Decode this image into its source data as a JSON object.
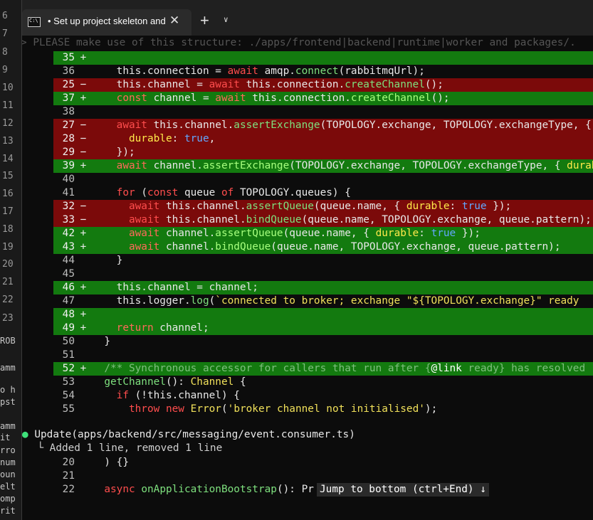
{
  "tab": {
    "title": "• Set up project skeleton and"
  },
  "left_gutter": {
    "numbers": [
      "6",
      "7",
      "8",
      "9",
      "10",
      "11",
      "12",
      "13",
      "14",
      "15",
      "16",
      "17",
      "18",
      "19",
      "20",
      "21",
      "22",
      "23"
    ],
    "fragments": [
      "ROB",
      "amm",
      "o h",
      "pst",
      "amm",
      "it",
      "rro",
      "num",
      "oun",
      "elt",
      "omp",
      "rit"
    ]
  },
  "prompt": "> PLEASE make use of this structure: ./apps/frontend|backend|runtime|worker and packages/.",
  "diff": [
    {
      "n": "35",
      "m": "+",
      "t": "add",
      "code": ""
    },
    {
      "n": "36",
      "m": "",
      "t": "ctx",
      "code": "    this.connection = await amqp.connect(rabbitmqUrl);"
    },
    {
      "n": "25",
      "m": "-",
      "t": "del",
      "code": "    this.channel = await this.connection.createChannel();"
    },
    {
      "n": "37",
      "m": "+",
      "t": "add",
      "code": "    const channel = await this.connection.createChannel();"
    },
    {
      "n": "38",
      "m": "",
      "t": "ctx",
      "code": ""
    },
    {
      "n": "27",
      "m": "-",
      "t": "del",
      "code": "    await this.channel.assertExchange(TOPOLOGY.exchange, TOPOLOGY.exchangeType, {"
    },
    {
      "n": "28",
      "m": "-",
      "t": "del",
      "code": "      durable: true,"
    },
    {
      "n": "29",
      "m": "-",
      "t": "del",
      "code": "    });"
    },
    {
      "n": "39",
      "m": "+",
      "t": "add",
      "code": "    await channel.assertExchange(TOPOLOGY.exchange, TOPOLOGY.exchangeType, { durable"
    },
    {
      "n": "40",
      "m": "",
      "t": "ctx",
      "code": ""
    },
    {
      "n": "41",
      "m": "",
      "t": "ctx",
      "code": "    for (const queue of TOPOLOGY.queues) {"
    },
    {
      "n": "32",
      "m": "-",
      "t": "del",
      "code": "      await this.channel.assertQueue(queue.name, { durable: true });"
    },
    {
      "n": "33",
      "m": "-",
      "t": "del",
      "code": "      await this.channel.bindQueue(queue.name, TOPOLOGY.exchange, queue.pattern);"
    },
    {
      "n": "42",
      "m": "+",
      "t": "add",
      "code": "      await channel.assertQueue(queue.name, { durable: true });"
    },
    {
      "n": "43",
      "m": "+",
      "t": "add",
      "code": "      await channel.bindQueue(queue.name, TOPOLOGY.exchange, queue.pattern);"
    },
    {
      "n": "44",
      "m": "",
      "t": "ctx",
      "code": "    }"
    },
    {
      "n": "45",
      "m": "",
      "t": "ctx",
      "code": ""
    },
    {
      "n": "46",
      "m": "+",
      "t": "add",
      "code": "    this.channel = channel;"
    },
    {
      "n": "47",
      "m": "",
      "t": "ctx",
      "code": "    this.logger.log(`connected to broker; exchange \"${TOPOLOGY.exchange}\" ready"
    },
    {
      "n": "48",
      "m": "+",
      "t": "add",
      "code": ""
    },
    {
      "n": "49",
      "m": "+",
      "t": "add",
      "code": "    return channel;"
    },
    {
      "n": "50",
      "m": "",
      "t": "ctx",
      "code": "  }"
    },
    {
      "n": "51",
      "m": "",
      "t": "ctx",
      "code": ""
    },
    {
      "n": "52",
      "m": "+",
      "t": "add",
      "code": "  /** Synchronous accessor for callers that run after {@link ready} has resolved"
    },
    {
      "n": "53",
      "m": "",
      "t": "ctx",
      "code": "  getChannel(): Channel {"
    },
    {
      "n": "54",
      "m": "",
      "t": "ctx",
      "code": "    if (!this.channel) {"
    },
    {
      "n": "55",
      "m": "",
      "t": "ctx",
      "code": "      throw new Error('broker channel not initialised');"
    }
  ],
  "update": {
    "bullet": "●",
    "text": "Update(apps/backend/src/messaging/event.consumer.ts)",
    "summary": "  └ Added 1 line, removed 1 line"
  },
  "diff2": [
    {
      "n": "20",
      "m": "",
      "t": "ctx",
      "code": "  ) {}"
    },
    {
      "n": "21",
      "m": "",
      "t": "ctx",
      "code": ""
    },
    {
      "n": "22",
      "m": "",
      "t": "ctx",
      "code": "  async onApplicationBootstrap(): Pr"
    }
  ],
  "jump_button": "Jump to bottom (ctrl+End) ↓"
}
